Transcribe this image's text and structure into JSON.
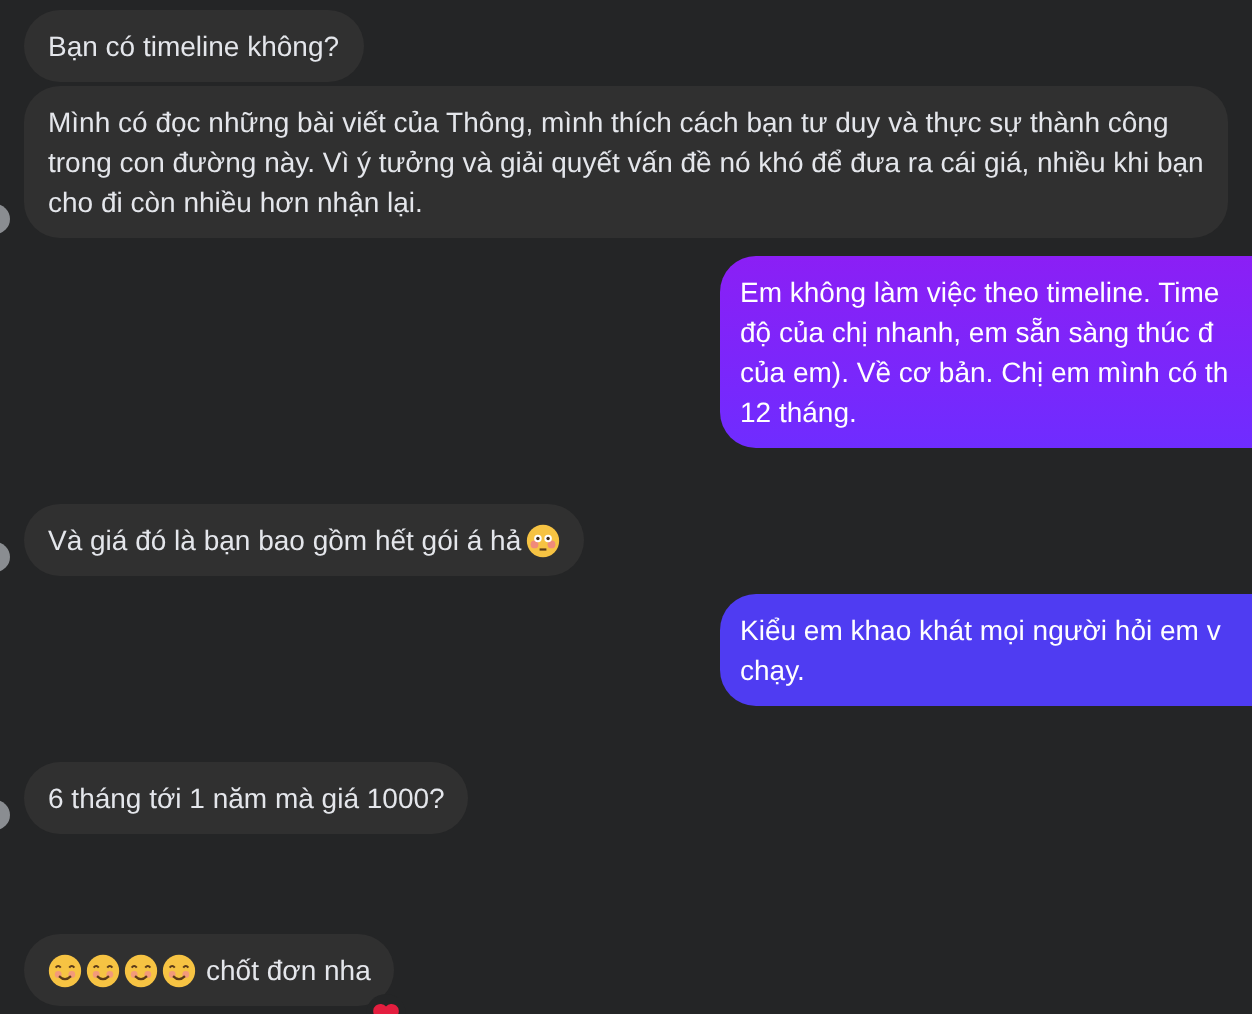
{
  "messages": [
    {
      "kind": "received",
      "avatar": false,
      "text": "Bạn có timeline không?"
    },
    {
      "kind": "received",
      "avatar": true,
      "text": "Mình có đọc những bài viết của Thông, mình thích cách bạn tư duy và thực sự thành công trong con đường này. Vì ý tưởng và giải quyết vấn đề nó khó để đưa ra cái giá, nhiều khi bạn cho đi còn nhiều hơn nhận lại."
    },
    {
      "kind": "sent",
      "avatar": false,
      "text": "Em không làm việc theo timeline. Time\nđộ của chị nhanh, em sẵn sàng thúc đ\ncủa em). Về cơ bản. Chị em mình có th\n12 tháng."
    },
    {
      "kind": "received",
      "avatar": true,
      "text": "Và giá đó là bạn bao gồm hết gói á hả",
      "trailing_emoji": [
        {
          "kind": "flushed"
        }
      ]
    },
    {
      "kind": "sent",
      "avatar": false,
      "text": "Kiểu em khao khát mọi người hỏi em v\nchạy."
    },
    {
      "kind": "received",
      "avatar": true,
      "text": "6 tháng tới 1 năm mà giá 1000?"
    },
    {
      "kind": "received",
      "avatar": false,
      "text": "chốt đơn nha",
      "leading_emoji": [
        {
          "kind": "smile"
        },
        {
          "kind": "smile"
        },
        {
          "kind": "smile"
        },
        {
          "kind": "smile"
        }
      ],
      "reaction": {
        "kind": "heart"
      }
    }
  ]
}
